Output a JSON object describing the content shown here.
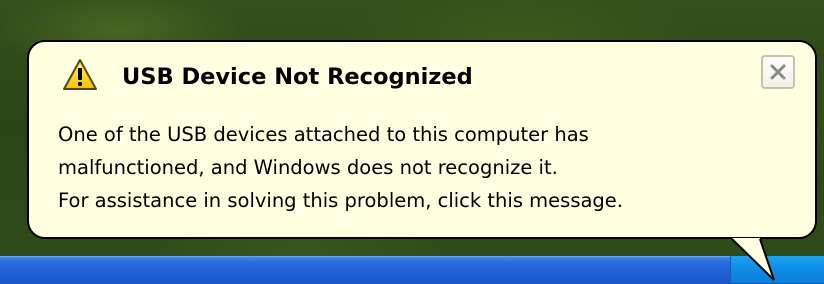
{
  "notification": {
    "title": "USB Device Not Recognized",
    "message_lines": [
      "One of the USB devices attached to this computer has",
      "malfunctioned, and Windows does not recognize it.",
      "For assistance in solving this problem, click this message."
    ],
    "icon": "warning-icon",
    "close_icon": "close-icon"
  },
  "colors": {
    "balloon_background": "#ffffe1",
    "taskbar": "#2060d6",
    "tray": "#0f8ce6"
  }
}
